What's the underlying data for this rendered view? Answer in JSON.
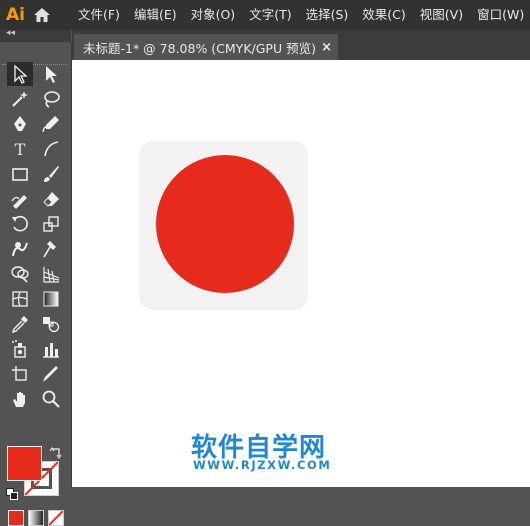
{
  "app": {
    "logo": "Ai"
  },
  "menu": [
    "文件(F)",
    "编辑(E)",
    "对象(O)",
    "文字(T)",
    "选择(S)",
    "效果(C)",
    "视图(V)",
    "窗口(W)"
  ],
  "toolbar": {
    "collapse": "◂◂",
    "tools": [
      {
        "name": "selection-tool-icon",
        "active": true
      },
      {
        "name": "direct-selection-tool-icon"
      },
      {
        "name": "magic-wand-tool-icon"
      },
      {
        "name": "lasso-tool-icon"
      },
      {
        "name": "pen-tool-icon"
      },
      {
        "name": "curvature-tool-icon"
      },
      {
        "name": "type-tool-icon",
        "glyph": "T"
      },
      {
        "name": "line-segment-tool-icon"
      },
      {
        "name": "rectangle-tool-icon"
      },
      {
        "name": "paintbrush-tool-icon"
      },
      {
        "name": "shaper-tool-icon"
      },
      {
        "name": "eraser-tool-icon"
      },
      {
        "name": "rotate-tool-icon"
      },
      {
        "name": "scale-tool-icon"
      },
      {
        "name": "warp-tool-icon"
      },
      {
        "name": "puppet-warp-tool-icon"
      },
      {
        "name": "shape-builder-tool-icon"
      },
      {
        "name": "perspective-grid-tool-icon"
      },
      {
        "name": "mesh-tool-icon"
      },
      {
        "name": "gradient-tool-icon"
      },
      {
        "name": "eyedropper-tool-icon"
      },
      {
        "name": "blend-tool-icon"
      },
      {
        "name": "symbol-sprayer-tool-icon"
      },
      {
        "name": "column-graph-tool-icon"
      },
      {
        "name": "artboard-tool-icon"
      },
      {
        "name": "slice-tool-icon"
      },
      {
        "name": "hand-tool-icon"
      },
      {
        "name": "zoom-tool-icon"
      }
    ],
    "fill_color": "#e62b1d",
    "stroke_color": "none"
  },
  "document": {
    "tab_title": "未标题-1* @ 78.08% (CMYK/GPU 预览)",
    "close": "×"
  },
  "artwork": {
    "background_color": "#f2f2f2",
    "circle_color": "#e62b1d"
  },
  "watermark": {
    "cn": "软件自学网",
    "en": "WWW.RJZXW.COM",
    "color": "#1f87d8"
  }
}
